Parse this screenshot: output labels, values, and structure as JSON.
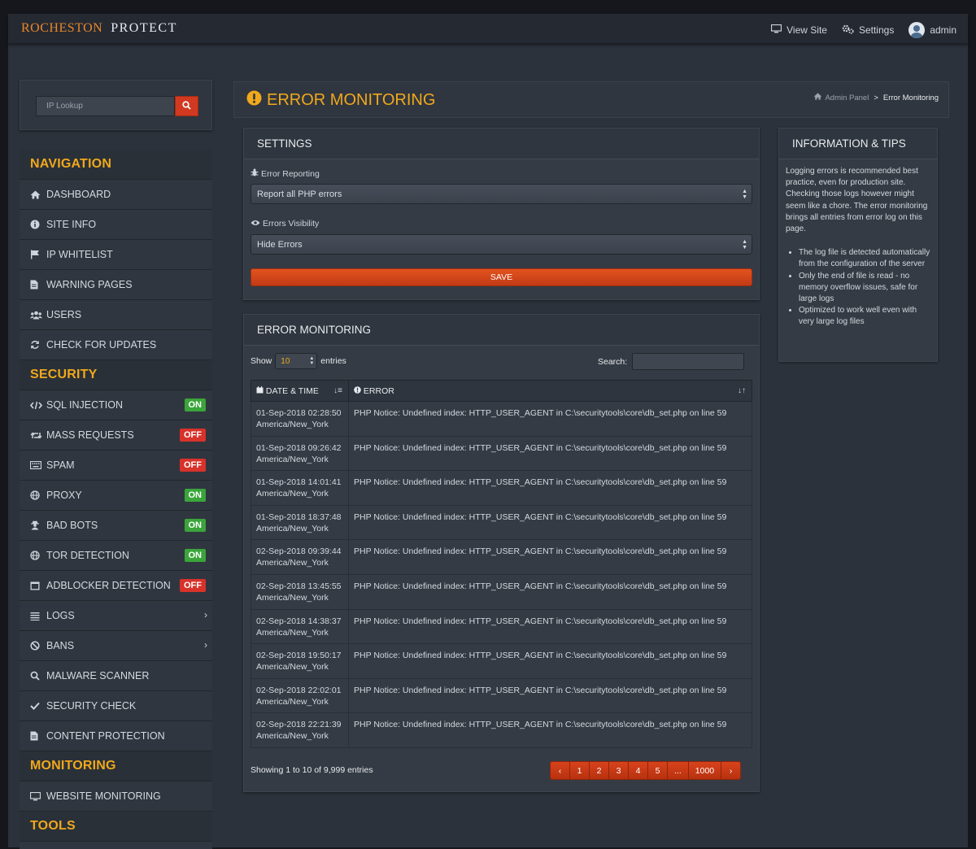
{
  "topbar": {
    "brand": "ROCHESTON",
    "product": "PROTECT",
    "view_site": "View Site",
    "settings": "Settings",
    "user": "admin"
  },
  "sidebar": {
    "ip_lookup_placeholder": "IP Lookup",
    "sections": [
      {
        "title": "NAVIGATION",
        "items": [
          {
            "label": "DASHBOARD",
            "icon": "home-icon"
          },
          {
            "label": "SITE INFO",
            "icon": "info-icon"
          },
          {
            "label": "IP WHITELIST",
            "icon": "flag-icon"
          },
          {
            "label": "WARNING PAGES",
            "icon": "file-icon"
          },
          {
            "label": "USERS",
            "icon": "users-icon"
          },
          {
            "label": "CHECK FOR UPDATES",
            "icon": "refresh-icon"
          }
        ]
      },
      {
        "title": "SECURITY",
        "items": [
          {
            "label": "SQL INJECTION",
            "icon": "code-icon",
            "badge": "ON"
          },
          {
            "label": "MASS REQUESTS",
            "icon": "retweet-icon",
            "badge": "OFF"
          },
          {
            "label": "SPAM",
            "icon": "keyboard-icon",
            "badge": "OFF"
          },
          {
            "label": "PROXY",
            "icon": "globe-icon",
            "badge": "ON"
          },
          {
            "label": "BAD BOTS",
            "icon": "user-secret-icon",
            "badge": "ON"
          },
          {
            "label": "TOR DETECTION",
            "icon": "globe-icon",
            "badge": "ON"
          },
          {
            "label": "ADBLOCKER DETECTION",
            "icon": "window-icon",
            "badge": "OFF"
          },
          {
            "label": "LOGS",
            "icon": "list-icon",
            "chevron": true
          },
          {
            "label": "BANS",
            "icon": "ban-icon",
            "chevron": true
          },
          {
            "label": "MALWARE SCANNER",
            "icon": "search-icon"
          },
          {
            "label": "SECURITY CHECK",
            "icon": "check-icon"
          },
          {
            "label": "CONTENT PROTECTION",
            "icon": "file-icon"
          }
        ]
      },
      {
        "title": "MONITORING",
        "items": [
          {
            "label": "WEBSITE MONITORING",
            "icon": "desktop-icon"
          }
        ]
      },
      {
        "title": "TOOLS",
        "items": []
      }
    ]
  },
  "page": {
    "title": "ERROR MONITORING",
    "breadcrumb_home": "Admin Panel",
    "breadcrumb_sep": ">",
    "breadcrumb_current": "Error Monitoring"
  },
  "settings": {
    "title": "SETTINGS",
    "error_reporting_label": "Error Reporting",
    "error_reporting_value": "Report all PHP errors",
    "visibility_label": "Errors Visibility",
    "visibility_value": "Hide Errors",
    "save_label": "SAVE"
  },
  "monitor": {
    "title": "ERROR MONITORING",
    "show_label": "Show",
    "entries_label": "entries",
    "length_value": "10",
    "search_label": "Search:",
    "col_datetime": "DATE & TIME",
    "col_error": "ERROR",
    "rows": [
      {
        "date": "01-Sep-2018 02:28:50",
        "tz": "America/New_York",
        "error": "PHP Notice: Undefined index: HTTP_USER_AGENT in C:\\securitytools\\core\\db_set.php on line 59"
      },
      {
        "date": "01-Sep-2018 09:26:42",
        "tz": "America/New_York",
        "error": "PHP Notice: Undefined index: HTTP_USER_AGENT in C:\\securitytools\\core\\db_set.php on line 59"
      },
      {
        "date": "01-Sep-2018 14:01:41",
        "tz": "America/New_York",
        "error": "PHP Notice: Undefined index: HTTP_USER_AGENT in C:\\securitytools\\core\\db_set.php on line 59"
      },
      {
        "date": "01-Sep-2018 18:37:48",
        "tz": "America/New_York",
        "error": "PHP Notice: Undefined index: HTTP_USER_AGENT in C:\\securitytools\\core\\db_set.php on line 59"
      },
      {
        "date": "02-Sep-2018 09:39:44",
        "tz": "America/New_York",
        "error": "PHP Notice: Undefined index: HTTP_USER_AGENT in C:\\securitytools\\core\\db_set.php on line 59"
      },
      {
        "date": "02-Sep-2018 13:45:55",
        "tz": "America/New_York",
        "error": "PHP Notice: Undefined index: HTTP_USER_AGENT in C:\\securitytools\\core\\db_set.php on line 59"
      },
      {
        "date": "02-Sep-2018 14:38:37",
        "tz": "America/New_York",
        "error": "PHP Notice: Undefined index: HTTP_USER_AGENT in C:\\securitytools\\core\\db_set.php on line 59"
      },
      {
        "date": "02-Sep-2018 19:50:17",
        "tz": "America/New_York",
        "error": "PHP Notice: Undefined index: HTTP_USER_AGENT in C:\\securitytools\\core\\db_set.php on line 59"
      },
      {
        "date": "02-Sep-2018 22:02:01",
        "tz": "America/New_York",
        "error": "PHP Notice: Undefined index: HTTP_USER_AGENT in C:\\securitytools\\core\\db_set.php on line 59"
      },
      {
        "date": "02-Sep-2018 22:21:39",
        "tz": "America/New_York",
        "error": "PHP Notice: Undefined index: HTTP_USER_AGENT in C:\\securitytools\\core\\db_set.php on line 59"
      }
    ],
    "showing_text": "Showing 1 to 10 of 9,999 entries",
    "pages": [
      "‹",
      "1",
      "2",
      "3",
      "4",
      "5",
      "...",
      "1000",
      "›"
    ]
  },
  "tips": {
    "title": "INFORMATION & TIPS",
    "intro": "Logging errors is recommended best practice, even for production site. Checking those logs however might seem like a chore. The error monitoring brings all entries from error log on this page.",
    "bullets": [
      "The log file is detected automatically from the configuration of the server",
      "Only the end of file is read - no memory overflow issues, safe for large logs",
      "Optimized to work well even with very large log files"
    ]
  },
  "colors": {
    "accent_orange": "#f0a81c",
    "brand_orange": "#e9862a",
    "button_red": "#d13a20",
    "on_green": "#3aa53a",
    "off_red": "#d8322a"
  }
}
